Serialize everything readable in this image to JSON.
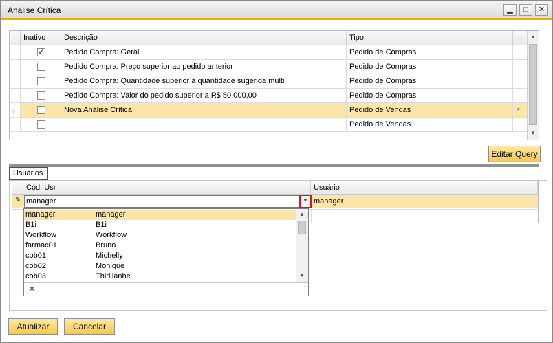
{
  "window": {
    "title": "Analise Crítica"
  },
  "grid1": {
    "headers": {
      "inativo": "Inativo",
      "descricao": "Descrição",
      "tipo": "Tipo",
      "more": "..."
    },
    "rows": [
      {
        "check": "✓",
        "descricao": "Pedido Compra: Geral",
        "tipo": "Pedido de Compras"
      },
      {
        "check": "",
        "descricao": "Pedido Compra: Preço superior ao pedido anterior",
        "tipo": "Pedido de Compras"
      },
      {
        "check": "",
        "descricao": "Pedido Compra: Quantidade superior à quantidade sugerida multi",
        "tipo": "Pedido de Compras"
      },
      {
        "check": "",
        "descricao": "Pedido Compra: Valor do pedido superior a R$ 50.000,00",
        "tipo": "Pedido de Compras"
      },
      {
        "check": "",
        "descricao": "Nova Análise Crítica",
        "tipo": "Pedido de Vendas"
      },
      {
        "check": "",
        "descricao": "",
        "tipo": "Pedido de Vendas"
      }
    ],
    "selected_mark": "›"
  },
  "buttons": {
    "editar_query": "Editar Query",
    "atualizar": "Atualizar",
    "cancelar": "Cancelar"
  },
  "users_tab": {
    "label": "Usuários"
  },
  "grid2": {
    "headers": {
      "cod_usr": "Cód. Usr",
      "usuario": "Usuário"
    },
    "row": {
      "cod_usr": "manager",
      "usuario": "manager"
    }
  },
  "dropdown": {
    "items": [
      {
        "code": "manager",
        "name": "manager"
      },
      {
        "code": "B1i",
        "name": "B1i"
      },
      {
        "code": "Workflow",
        "name": "Workflow"
      },
      {
        "code": "farmac01",
        "name": "Bruno"
      },
      {
        "code": "cob01",
        "name": "Michelly"
      },
      {
        "code": "cob02",
        "name": "Monique"
      },
      {
        "code": "cob03",
        "name": "Thirllianhe"
      }
    ],
    "close_glyph": "×"
  }
}
